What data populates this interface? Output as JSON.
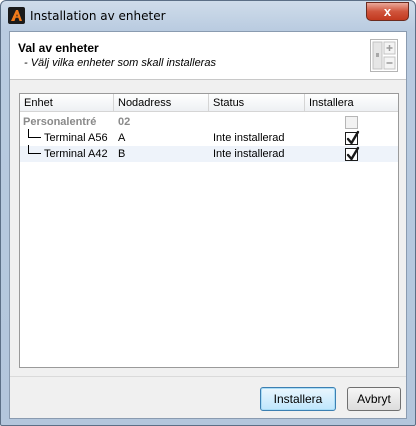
{
  "window": {
    "title": "Installation av enheter",
    "close_glyph": "x"
  },
  "header": {
    "title": "Val av enheter",
    "subtitle": "- Välj vilka enheter som skall installeras",
    "icon": "device-panel-icon"
  },
  "table": {
    "columns": [
      "Enhet",
      "Nodadress",
      "Status",
      "Installera"
    ],
    "rows": [
      {
        "unit": "Personalentré",
        "node": "02",
        "status": "",
        "install": false,
        "group": true,
        "enabled": false
      },
      {
        "unit": "Terminal A56",
        "node": "A",
        "status": "Inte installerad",
        "install": true,
        "group": false,
        "enabled": true
      },
      {
        "unit": "Terminal A42",
        "node": "B",
        "status": "Inte installerad",
        "install": true,
        "group": false,
        "enabled": true
      }
    ]
  },
  "buttons": {
    "install": "Installera",
    "cancel": "Avbryt"
  },
  "colors": {
    "accent": "#3c7fb1",
    "close": "#c2391f",
    "alt_row": "#eef3fa"
  }
}
